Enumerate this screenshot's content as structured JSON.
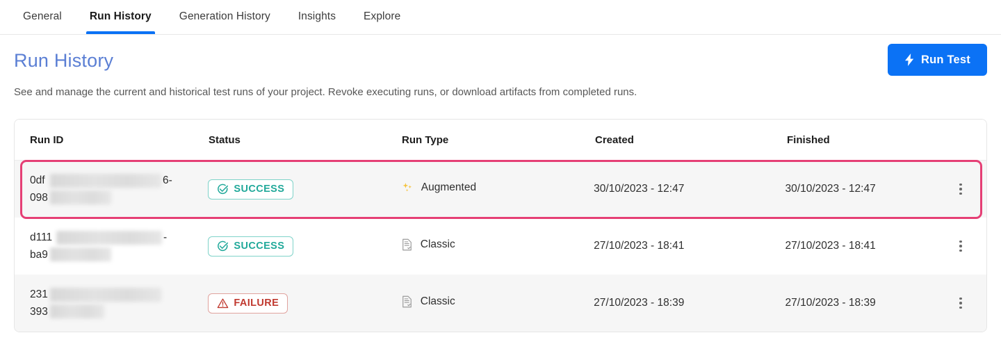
{
  "theme": {
    "accent": "#0b72f5",
    "title_color": "#5b7fd4",
    "highlight_color": "#e53f75",
    "success_color": "#21a99a",
    "failure_color": "#c0392f",
    "augmented_icon_color": "#f5c23a",
    "classic_icon_color": "#9a9a9a"
  },
  "tabs": [
    {
      "label": "General",
      "active": false
    },
    {
      "label": "Run History",
      "active": true
    },
    {
      "label": "Generation History",
      "active": false
    },
    {
      "label": "Insights",
      "active": false
    },
    {
      "label": "Explore",
      "active": false
    }
  ],
  "header": {
    "title": "Run History",
    "description": "See and manage the current and historical test runs of your project. Revoke executing runs, or download artifacts from completed runs.",
    "run_test_label": "Run Test",
    "run_test_icon": "lightning-bolt-icon"
  },
  "table": {
    "columns": [
      "Run ID",
      "Status",
      "Run Type",
      "Created",
      "Finished"
    ],
    "rows": [
      {
        "run_id_line1_prefix": "0df",
        "run_id_line1_suffix": "6-",
        "run_id_line2_prefix": "098",
        "run_id_line2_suffix": "",
        "status": "SUCCESS",
        "status_icon": "check-circle-icon",
        "run_type": "Augmented",
        "run_type_icon": "sparkles-icon",
        "created": "30/10/2023 - 12:47",
        "finished": "30/10/2023 - 12:47",
        "menu_icon": "kebab-menu-icon",
        "highlighted": true
      },
      {
        "run_id_line1_prefix": "d111",
        "run_id_line1_suffix": "-",
        "run_id_line2_prefix": "ba9",
        "run_id_line2_suffix": "",
        "status": "SUCCESS",
        "status_icon": "check-circle-icon",
        "run_type": "Classic",
        "run_type_icon": "document-icon",
        "created": "27/10/2023 - 18:41",
        "finished": "27/10/2023 - 18:41",
        "menu_icon": "kebab-menu-icon",
        "highlighted": false
      },
      {
        "run_id_line1_prefix": "231",
        "run_id_line1_suffix": "",
        "run_id_line2_prefix": "393",
        "run_id_line2_suffix": "",
        "status": "FAILURE",
        "status_icon": "warning-triangle-icon",
        "run_type": "Classic",
        "run_type_icon": "document-icon",
        "created": "27/10/2023 - 18:39",
        "finished": "27/10/2023 - 18:39",
        "menu_icon": "kebab-menu-icon",
        "highlighted": false
      }
    ]
  }
}
